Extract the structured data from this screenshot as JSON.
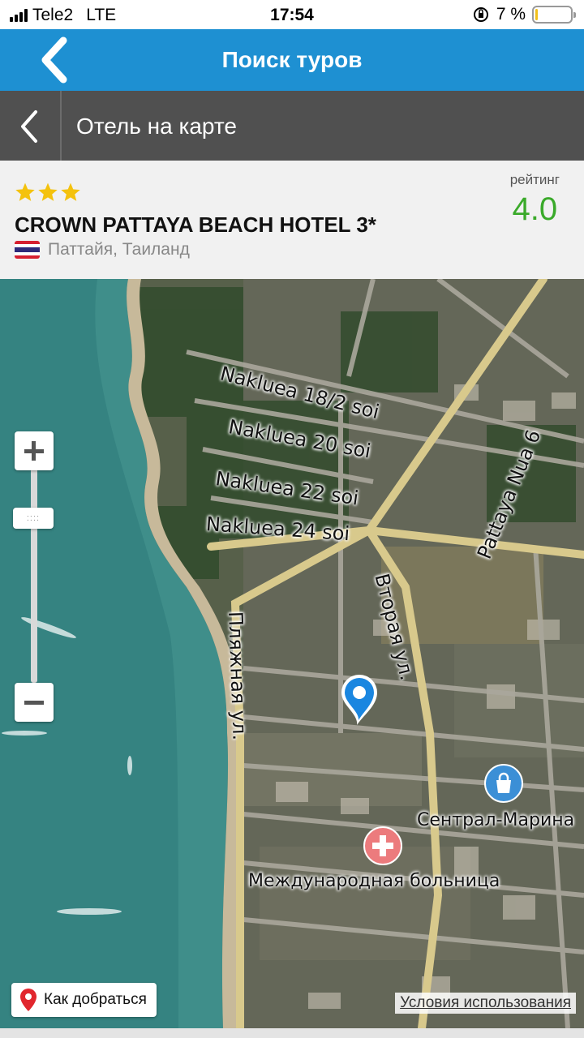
{
  "status_bar": {
    "carrier": "Tele2",
    "network": "LTE",
    "time": "17:54",
    "battery_percent": "7 %",
    "battery_level": 0.07
  },
  "header": {
    "title": "Поиск туров"
  },
  "sub_header": {
    "title": "Отель на карте"
  },
  "hotel": {
    "stars": 3,
    "name": "CROWN PATTAYA BEACH HOTEL 3*",
    "location": "Паттайя, Таиланд",
    "rating_label": "рейтинг",
    "rating_value": "4.0",
    "rating_color": "#3aaa2a",
    "star_color": "#f4c20d"
  },
  "map": {
    "streets": [
      "Naklueа 18/2 soi",
      "Naklueа 20 soi",
      "Naklueа 22 soi",
      "Naklueа 24 soi",
      "Pattaya Nua 6",
      "Вторая ул.",
      "Пляжная ул."
    ],
    "pois": [
      {
        "name": "Сентрал-Марина",
        "icon": "shopping-bag-icon"
      },
      {
        "name": "Международная больница",
        "icon": "hospital-cross-icon"
      }
    ],
    "zoom_thumb_label": "::::",
    "route_button": "Как добраться",
    "terms_link": "Условия использования"
  },
  "colors": {
    "header_bg": "#1e90d2",
    "sub_header_bg": "#505050",
    "sea": "#3f8e8a",
    "road": "#d8c98c"
  }
}
